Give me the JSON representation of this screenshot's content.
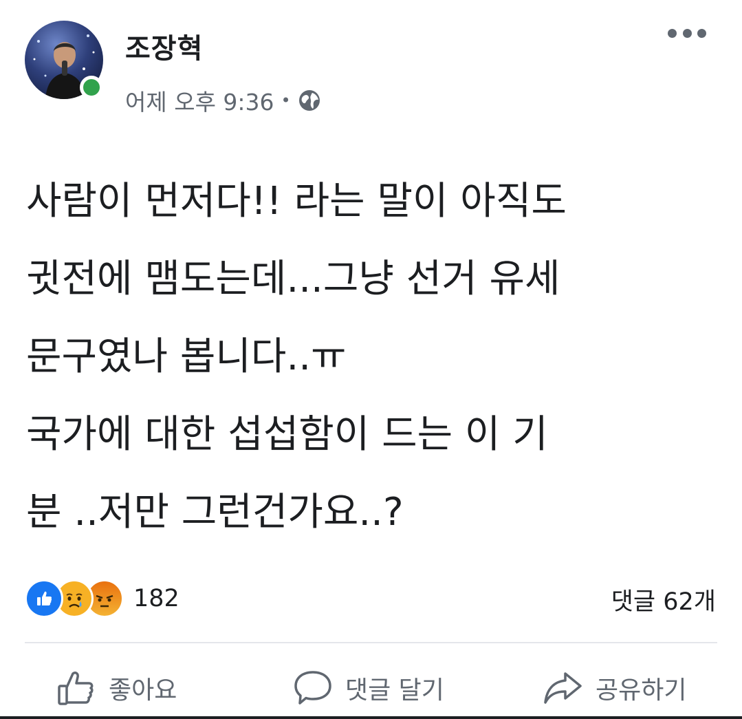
{
  "post": {
    "author": "조장혁",
    "timestamp": "어제 오후 9:36",
    "separator": "•",
    "privacy_icon": "globe-icon",
    "more_icon": "more-options-icon",
    "message_lines": [
      "사람이 먼저다!! 라는 말이 아직도",
      "귓전에 맴도는데...그냥 선거 유세",
      "문구였나 봅니다..ㅠ",
      "국가에 대한 섭섭함이 드는 이 기",
      "분 ..저만 그런건가요..?"
    ]
  },
  "reactions": {
    "types": [
      "like",
      "sad",
      "angry"
    ],
    "count": "182",
    "comments": "댓글 62개"
  },
  "actions": {
    "like": "좋아요",
    "comment": "댓글 달기",
    "share": "공유하기"
  },
  "colors": {
    "like_blue": "#1877f2",
    "online_green": "#31a24c",
    "secondary_text": "#606770"
  }
}
